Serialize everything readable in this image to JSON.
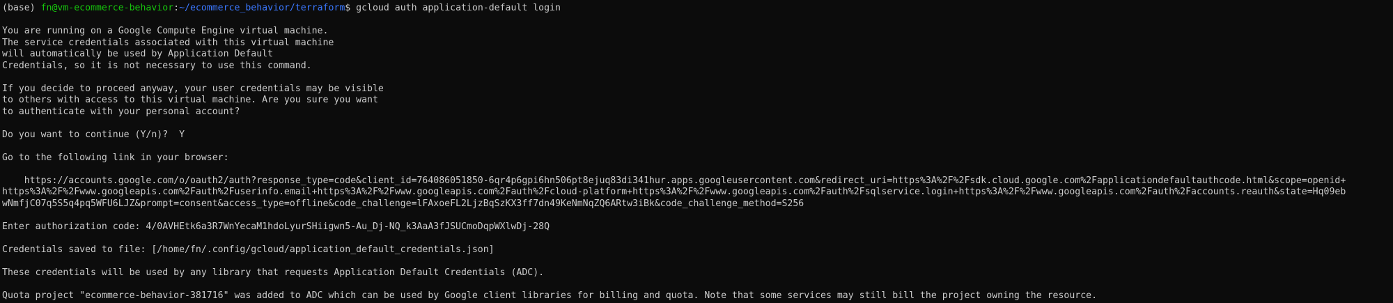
{
  "colors": {
    "background": "#0c0c0c",
    "foreground": "#cccccc",
    "user_host": "#16c60c",
    "path": "#3b78ff"
  },
  "prompt": {
    "env": "(base) ",
    "user_host": "fn@vm-ecommerce-behavior",
    "separator": ":",
    "path": "~/ecommerce_behavior/terraform",
    "symbol": "$ ",
    "command": "gcloud auth application-default login"
  },
  "output": {
    "gce_notice": [
      "You are running on a Google Compute Engine virtual machine.",
      "The service credentials associated with this virtual machine",
      "will automatically be used by Application Default",
      "Credentials, so it is not necessary to use this command."
    ],
    "warning": [
      "If you decide to proceed anyway, your user credentials may be visible",
      "to others with access to this virtual machine. Are you sure you want",
      "to authenticate with your personal account?"
    ],
    "continue_prompt": "Do you want to continue (Y/n)?  Y",
    "link_intro": "Go to the following link in your browser:",
    "auth_url": [
      "    https://accounts.google.com/o/oauth2/auth?response_type=code&client_id=764086051850-6qr4p6gpi6hn506pt8ejuq83di341hur.apps.googleusercontent.com&redirect_uri=https%3A%2F%2Fsdk.cloud.google.com%2Fapplicationdefaultauthcode.html&scope=openid+",
      "https%3A%2F%2Fwww.googleapis.com%2Fauth%2Fuserinfo.email+https%3A%2F%2Fwww.googleapis.com%2Fauth%2Fcloud-platform+https%3A%2F%2Fwww.googleapis.com%2Fauth%2Fsqlservice.login+https%3A%2F%2Fwww.googleapis.com%2Fauth%2Faccounts.reauth&state=Hq09eb",
      "wNmfjC07q5S5q4pq5WFU6LJZ&prompt=consent&access_type=offline&code_challenge=lFAxoeFL2LjzBqSzKX3ff7dn49KeNmNqZQ6ARtw3iBk&code_challenge_method=S256"
    ],
    "auth_code": "Enter authorization code: 4/0AVHEtk6a3R7WnYecaM1hdoLyurSHiigwn5-Au_Dj-NQ_k3AaA3fJSUCmoDqpWXlwDj-28Q",
    "saved": "Credentials saved to file: [/home/fn/.config/gcloud/application_default_credentials.json]",
    "usage": "These credentials will be used by any library that requests Application Default Credentials (ADC).",
    "quota": "Quota project \"ecommerce-behavior-381716\" was added to ADC which can be used by Google client libraries for billing and quota. Note that some services may still bill the project owning the resource."
  }
}
